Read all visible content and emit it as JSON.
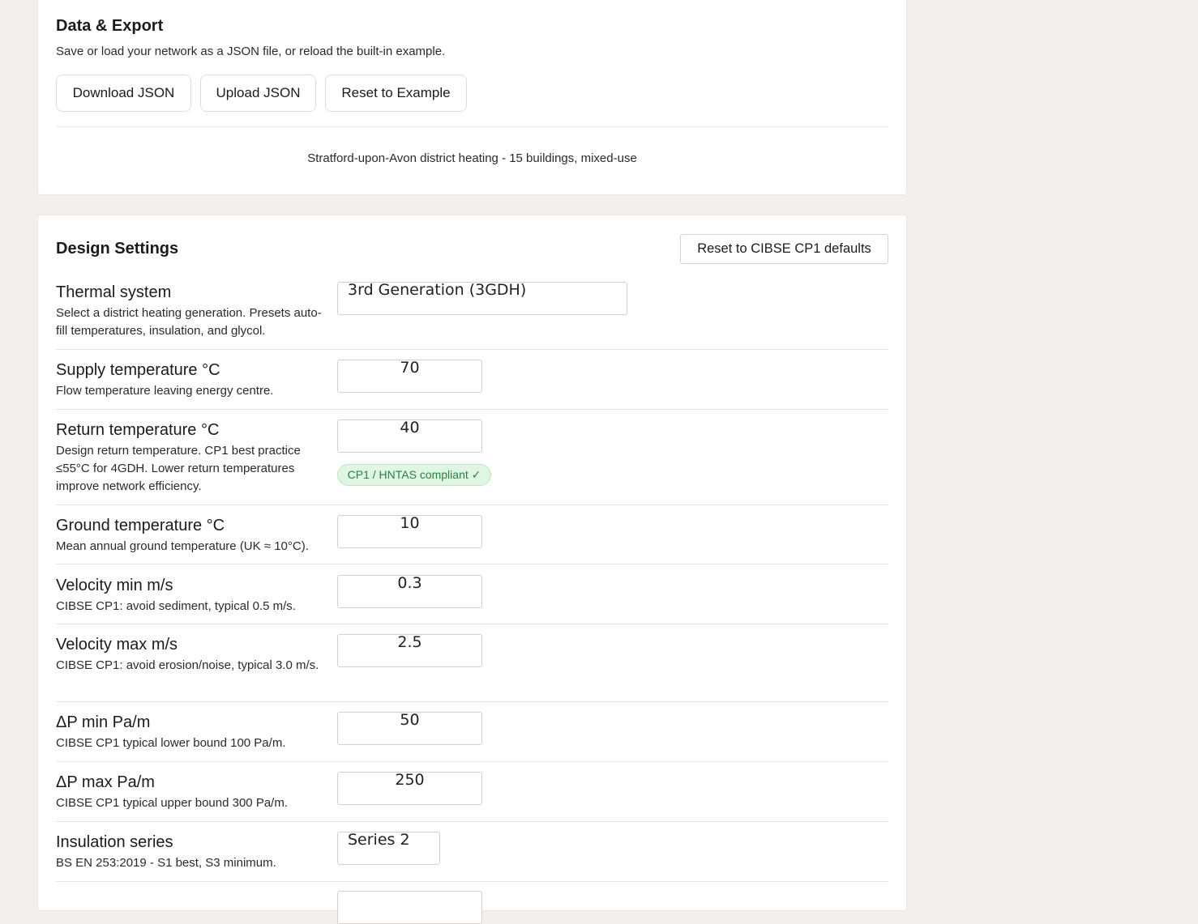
{
  "export": {
    "title": "Data & Export",
    "subtitle": "Save or load your network as a JSON file, or reload the built-in example.",
    "buttons": {
      "download": "Download JSON",
      "upload": "Upload JSON",
      "reset_example": "Reset to Example"
    },
    "network_name": "Stratford-upon-Avon district heating - 15 buildings, mixed-use"
  },
  "design": {
    "title": "Design Settings",
    "reset_label": "Reset to CIBSE CP1 defaults",
    "rows": [
      {
        "label": "Thermal system",
        "desc": "Select a district heating generation. Presets auto-fill temperatures, insulation, and glycol.",
        "value": "3rd Generation (3GDH)"
      },
      {
        "label": "Supply temperature °C",
        "desc": "Flow temperature leaving energy centre.",
        "value": "70"
      },
      {
        "label": "Return temperature °C",
        "desc": "Design return temperature. CP1 best practice ≤55°C for 4GDH. Lower return temperatures improve network efficiency.",
        "value": "40",
        "badge": "CP1 / HNTAS compliant ✓"
      },
      {
        "label": "Ground temperature °C",
        "desc": "Mean annual ground temperature (UK ≈ 10°C).",
        "value": "10"
      },
      {
        "label": "Velocity min m/s",
        "desc": "CIBSE CP1: avoid sediment, typical 0.5 m/s.",
        "value": "0.3"
      },
      {
        "label": "Velocity max m/s",
        "desc": "CIBSE CP1: avoid erosion/noise, typical 3.0 m/s.",
        "value": "2.5"
      },
      {
        "label": "ΔP min Pa/m",
        "desc": "CIBSE CP1 typical lower bound 100 Pa/m.",
        "value": "50"
      },
      {
        "label": "ΔP max Pa/m",
        "desc": "CIBSE CP1 typical upper bound 300 Pa/m.",
        "value": "250"
      },
      {
        "label": "Insulation series",
        "desc": "BS EN 253:2019 - S1 best, S3 minimum.",
        "value": "Series 2"
      }
    ]
  },
  "colors": {
    "page_bg": "#f3efeb",
    "card_bg": "#ffffff",
    "badge_bg": "#dff6e3",
    "badge_text": "#2e7d45"
  }
}
